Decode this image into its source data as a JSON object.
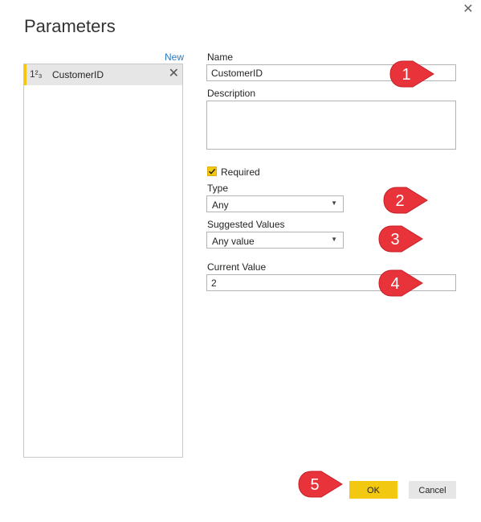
{
  "dialog": {
    "title": "Parameters",
    "close_glyph": "✕"
  },
  "list": {
    "new_label": "New",
    "items": [
      {
        "type_glyph": "1²₃",
        "label": "CustomerID",
        "remove_glyph": "✕"
      }
    ]
  },
  "form": {
    "name_label": "Name",
    "name_value": "CustomerID",
    "description_label": "Description",
    "description_value": "",
    "required_label": "Required",
    "required_checked": true,
    "type_label": "Type",
    "type_value": "Any",
    "suggested_label": "Suggested Values",
    "suggested_value": "Any value",
    "current_label": "Current Value",
    "current_value": "2"
  },
  "buttons": {
    "ok": "OK",
    "cancel": "Cancel"
  },
  "callouts": [
    "1",
    "2",
    "3",
    "4",
    "5"
  ],
  "colors": {
    "accent": "#f2c811",
    "callout": "#e8333a",
    "link": "#2b79c2"
  },
  "icons": {
    "close": "close-icon",
    "number_type": "number-type-icon",
    "remove": "remove-icon",
    "checkmark": "checkmark-icon",
    "dropdown": "chevron-down-icon"
  }
}
